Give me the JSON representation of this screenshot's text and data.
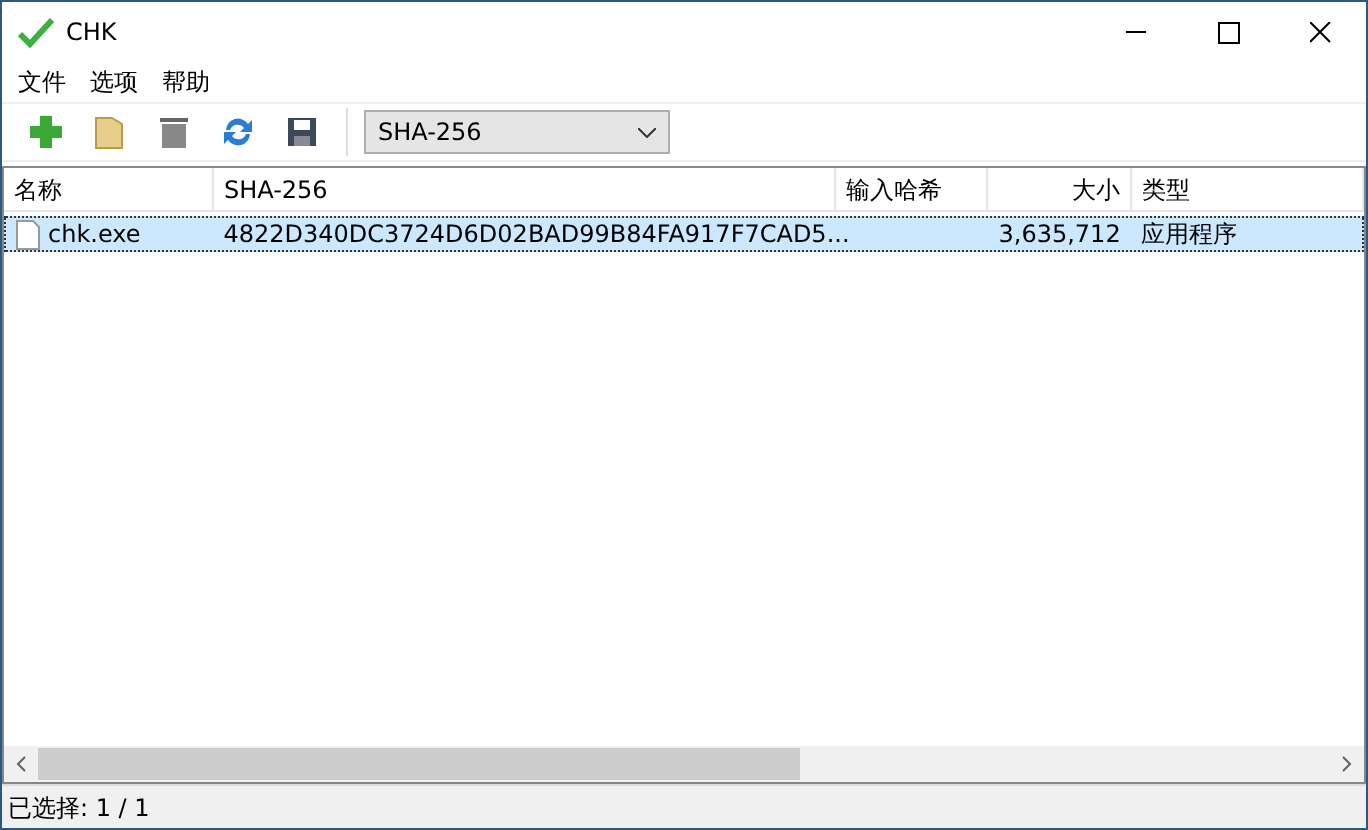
{
  "window": {
    "title": "CHK"
  },
  "menu": [
    "文件",
    "选项",
    "帮助"
  ],
  "toolbar": {
    "hash_select": {
      "value": "SHA-256"
    }
  },
  "table": {
    "columns": [
      {
        "label": "名称"
      },
      {
        "label": "SHA-256"
      },
      {
        "label": "输入哈希"
      },
      {
        "label": "大小"
      },
      {
        "label": "类型"
      }
    ],
    "rows": [
      {
        "selected": true,
        "cells": [
          "chk.exe",
          "4822D340DC3724D6D02BAD99B84FA917F7CAD5...",
          "",
          "3,635,712",
          "应用程序"
        ]
      }
    ]
  },
  "status_bar": "已选择: 1 / 1"
}
